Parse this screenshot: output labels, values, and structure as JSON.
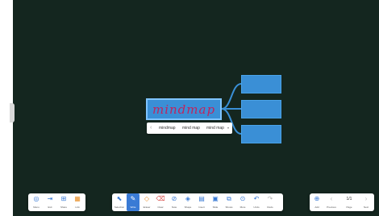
{
  "mindmap": {
    "central_text": "mindmap",
    "children_count": 3
  },
  "suggestions": {
    "prev_icon": "chevron-left-icon",
    "items": [
      "mindmap",
      "mind map",
      "mind map"
    ],
    "more_icon": "chevron-down-icon"
  },
  "left_toolbar": {
    "items": [
      {
        "label": "Menu",
        "icon": "menu-icon"
      },
      {
        "label": "Exit",
        "icon": "exit-icon"
      },
      {
        "label": "Share",
        "icon": "share-icon"
      },
      {
        "label": "Link",
        "icon": "link-icon"
      }
    ]
  },
  "center_toolbar": {
    "items": [
      {
        "label": "Selection",
        "icon": "cursor-icon"
      },
      {
        "label": "Write",
        "icon": "pen-icon",
        "active": true
      },
      {
        "label": "Eraser",
        "icon": "eraser-icon"
      },
      {
        "label": "Clear",
        "icon": "clear-icon"
      },
      {
        "label": "Note",
        "icon": "note-icon"
      },
      {
        "label": "Shape",
        "icon": "shape-icon"
      },
      {
        "label": "Insert",
        "icon": "insert-icon"
      },
      {
        "label": "Slide",
        "icon": "slide-icon"
      },
      {
        "label": "Shows",
        "icon": "shows-icon"
      },
      {
        "label": "More",
        "icon": "more-icon"
      },
      {
        "label": "Undo",
        "icon": "undo-icon"
      },
      {
        "label": "Redo",
        "icon": "redo-icon"
      }
    ]
  },
  "right_toolbar": {
    "items": [
      {
        "label": "Add",
        "icon": "add-icon"
      },
      {
        "label": "Previous",
        "icon": "chevron-left-icon"
      },
      {
        "label": "Page",
        "value": "1/1"
      },
      {
        "label": "Next",
        "icon": "chevron-right-icon"
      }
    ]
  },
  "colors": {
    "board": "#14261f",
    "node": "#3a8fd6",
    "ink": "#c0245e",
    "toolbar_accent": "#3a7bd5"
  }
}
